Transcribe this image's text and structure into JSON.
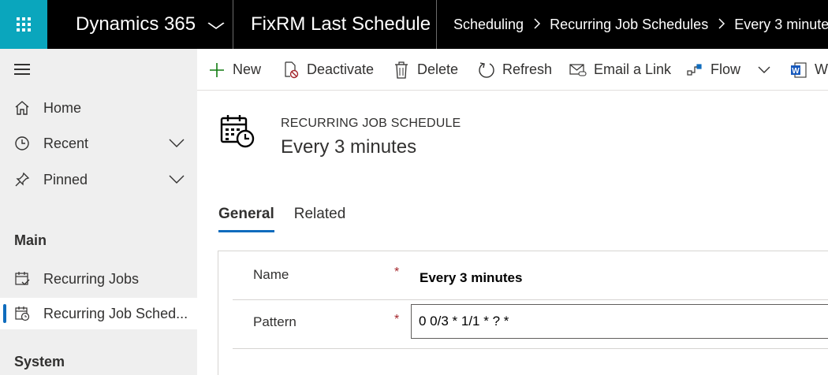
{
  "topbar": {
    "app_name": "Dynamics 365",
    "environment_name": "FixRM Last Schedule",
    "breadcrumb": [
      "Scheduling",
      "Recurring Job Schedules",
      "Every 3 minutes"
    ],
    "accent_color": "#0aa6bd"
  },
  "sidebar": {
    "items": [
      {
        "label": "Home",
        "icon": "home-icon"
      },
      {
        "label": "Recent",
        "icon": "clock-icon"
      },
      {
        "label": "Pinned",
        "icon": "pin-icon"
      }
    ],
    "groups": [
      {
        "title": "Main",
        "items": [
          {
            "label": "Recurring Jobs",
            "icon": "calendar-check-icon"
          },
          {
            "label": "Recurring Job Sched...",
            "icon": "calendar-clock-icon",
            "selected": true
          }
        ]
      },
      {
        "title": "System"
      }
    ]
  },
  "commands": [
    {
      "label": "New",
      "icon": "plus-icon"
    },
    {
      "label": "Deactivate",
      "icon": "deactivate-icon"
    },
    {
      "label": "Delete",
      "icon": "trash-icon"
    },
    {
      "label": "Refresh",
      "icon": "refresh-icon"
    },
    {
      "label": "Email a Link",
      "icon": "email-link-icon"
    },
    {
      "label": "Flow",
      "icon": "flow-icon"
    },
    {
      "label": "Wo",
      "icon": "word-icon"
    }
  ],
  "form": {
    "entity_type": "RECURRING JOB SCHEDULE",
    "title": "Every 3 minutes",
    "tabs": [
      {
        "label": "General",
        "active": true
      },
      {
        "label": "Related",
        "active": false
      }
    ],
    "fields": [
      {
        "label": "Name",
        "required_mark": "*",
        "value": "Every 3 minutes"
      },
      {
        "label": "Pattern",
        "required_mark": "*",
        "value": "0 0/3 * 1/1 * ? *"
      }
    ]
  }
}
